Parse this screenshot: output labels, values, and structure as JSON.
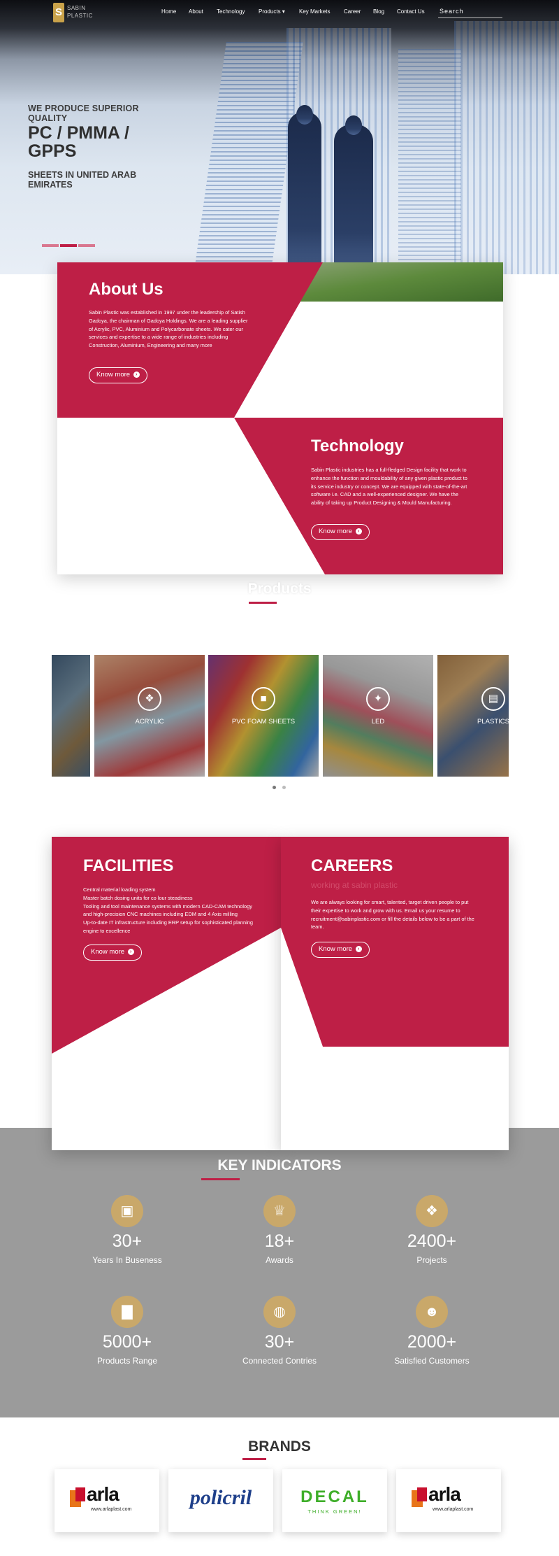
{
  "nav": {
    "logo_letter": "S",
    "logo_line1": "SABIN",
    "logo_line2": "PLASTIC",
    "items": [
      "Home",
      "About",
      "Technology",
      "Products ▾",
      "Key Markets",
      "Career",
      "Blog",
      "Contact Us"
    ],
    "search_placeholder": "Search"
  },
  "hero": {
    "line1": "WE PRODUCE SUPERIOR",
    "line1b": "QUALITY",
    "big1": "PC / PMMA /",
    "big2": "GPPS",
    "line2": "SHEETS IN UNITED ARAB",
    "line2b": "EMIRATES"
  },
  "about": {
    "title": "About Us",
    "body": "Sabin Plastic was established in 1997 under the leadership of Satish Gadoya, the chairman of Gadoya Holdings. We are a leading supplier of Acrylic, PVC, Aluminium and Polycarbonate sheets. We cater our services and expertise to a wide range of industries including Construction, Aluminium, Engineering and many more",
    "button": "Know more"
  },
  "technology": {
    "title": "Technology",
    "body": "Sabin Plastic industries has a full-fledged Design facility that work to enhance the function and mouldability of any given plastic product to its service industry or concept. We are equipped with state-of-the-art software i.e. CAD and a well-experienced designer. We have the ability of taking up Product Designing & Mould Manufacturing.",
    "button": "Know more"
  },
  "products": {
    "title": "Products",
    "items": [
      {
        "label": "",
        "icon": ""
      },
      {
        "label": "ACRYLIC",
        "icon": "❖"
      },
      {
        "label": "PVC FOAM SHEETS",
        "icon": "■"
      },
      {
        "label": "LED",
        "icon": "✦"
      },
      {
        "label": "PLASTICS",
        "icon": "▤"
      }
    ]
  },
  "facilities": {
    "title": "FACILITIES",
    "lines": [
      "Central material loading system",
      "Master batch dosing units for co lour steadiness",
      "Tooling and tool maintenance systems with modern CAD-CAM technology and high-precision CNC machines including EDM and 4 Axis milling",
      "Up-to-date IT infrastructure including ERP setup for sophisticated planning engine to excellence"
    ],
    "button": "Know more"
  },
  "careers": {
    "title": "CAREERS",
    "subtitle": "working at sabin plastic",
    "body": "We are always looking for smart, talented, target driven people to put their expertise to work and grow with us. Email us your resume to recruitment@sabinplastic.com or fill the details below to be a part of the team.",
    "button": "Know more"
  },
  "key": {
    "title": "KEY INDICATORS",
    "items": [
      {
        "value": "30+",
        "label": "Years In Buseness",
        "icon": "briefcase-icon",
        "glyph": "▣"
      },
      {
        "value": "18+",
        "label": "Awards",
        "icon": "trophy-icon",
        "glyph": "♕"
      },
      {
        "value": "2400+",
        "label": "Projects",
        "icon": "cubes-icon",
        "glyph": "❖"
      },
      {
        "value": "5000+",
        "label": "Products Range",
        "icon": "chart-icon",
        "glyph": "▇"
      },
      {
        "value": "30+",
        "label": "Connected Contries",
        "icon": "globe-icon",
        "glyph": "◍"
      },
      {
        "value": "2000+",
        "label": "Satisfied Customers",
        "icon": "users-icon",
        "glyph": "☻"
      }
    ]
  },
  "brands": {
    "title": "BRANDS",
    "items": [
      {
        "name": "arla",
        "sub": "www.arlaplast.com"
      },
      {
        "name": "policril",
        "sub": ""
      },
      {
        "name": "DECAL",
        "sub": "THINK GREEN!"
      },
      {
        "name": "arla",
        "sub": "www.arlaplast.com"
      }
    ]
  },
  "colors": {
    "accent": "#be1f46",
    "gold": "#c9a86a",
    "gray": "#9b9b9b"
  }
}
